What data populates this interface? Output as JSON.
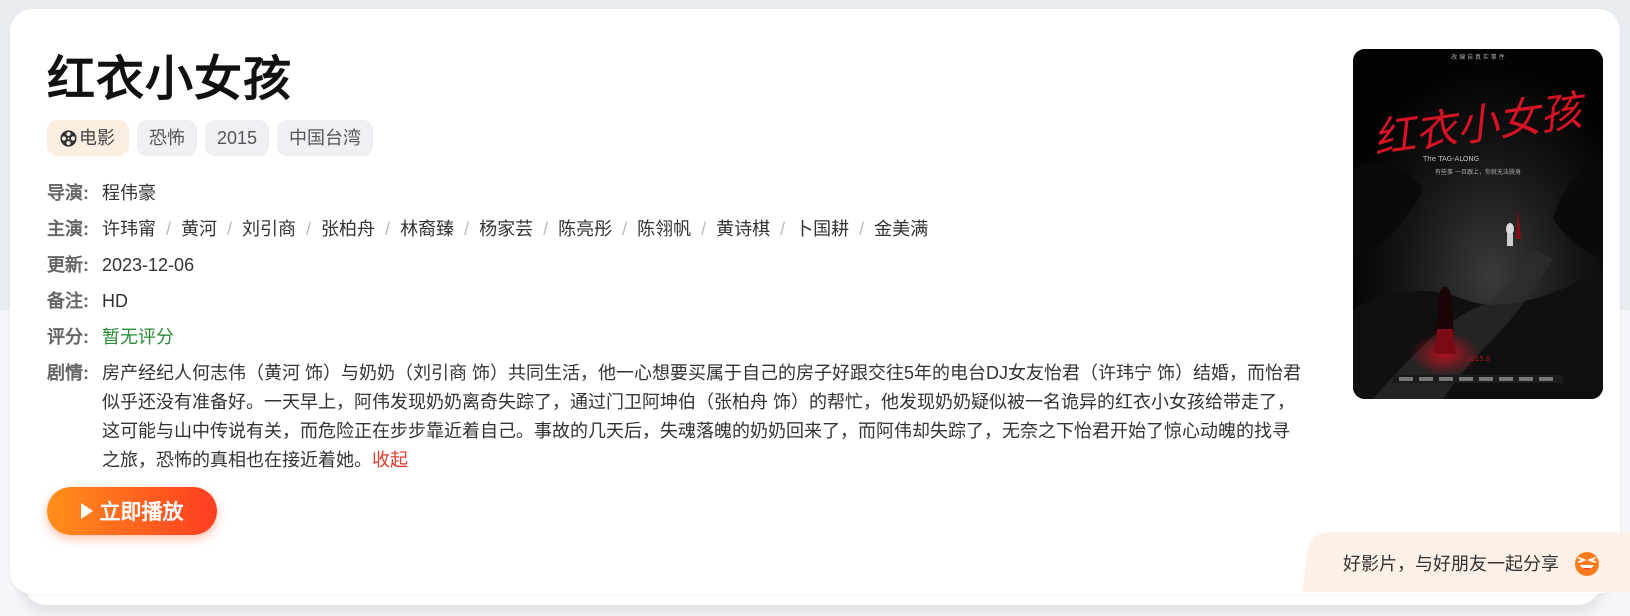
{
  "title": "红衣小女孩",
  "tags": {
    "type": "电影",
    "genre": "恐怖",
    "year": "2015",
    "region": "中国台湾"
  },
  "info": {
    "director_label": "导演:",
    "director": "程伟豪",
    "actors_label": "主演:",
    "actors": [
      "许玮甯",
      "黄河",
      "刘引商",
      "张柏舟",
      "林裔臻",
      "杨家芸",
      "陈亮彤",
      "陈翎帆",
      "黄诗棋",
      "卜国耕",
      "金美满"
    ],
    "actor_separator": "/",
    "update_label": "更新:",
    "update": "2023-12-06",
    "note_label": "备注:",
    "note": "HD",
    "score_label": "评分:",
    "score": "暂无评分",
    "plot_label": "剧情:",
    "plot": "房产经纪人何志伟（黄河 饰）与奶奶（刘引商 饰）共同生活，他一心想要买属于自己的房子好跟交往5年的电台DJ女友怡君（许玮宁 饰）结婚，而怡君似乎还没有准备好。一天早上，阿伟发现奶奶离奇失踪了，通过门卫阿坤伯（张柏舟 饰）的帮忙，他发现奶奶疑似被一名诡异的红衣小女孩给带走了，这可能与山中传说有关，而危险正在步步靠近着自己。事故的几天后，失魂落魄的奶奶回来了，而阿伟却失踪了，无奈之下怡君开始了惊心动魄的找寻之旅，恐怖的真相也在接近着她。",
    "collapse": "收起"
  },
  "play_button": "立即播放",
  "poster": {
    "title_art": "红衣小女孩",
    "subtitle": "The TAG-ALONG",
    "year_text": "2015.8"
  },
  "share": {
    "text": "好影片，与好朋友一起分享"
  },
  "colors": {
    "accent": "#ff3d22",
    "score": "#2a8b36",
    "collapse": "#e23a2e"
  }
}
